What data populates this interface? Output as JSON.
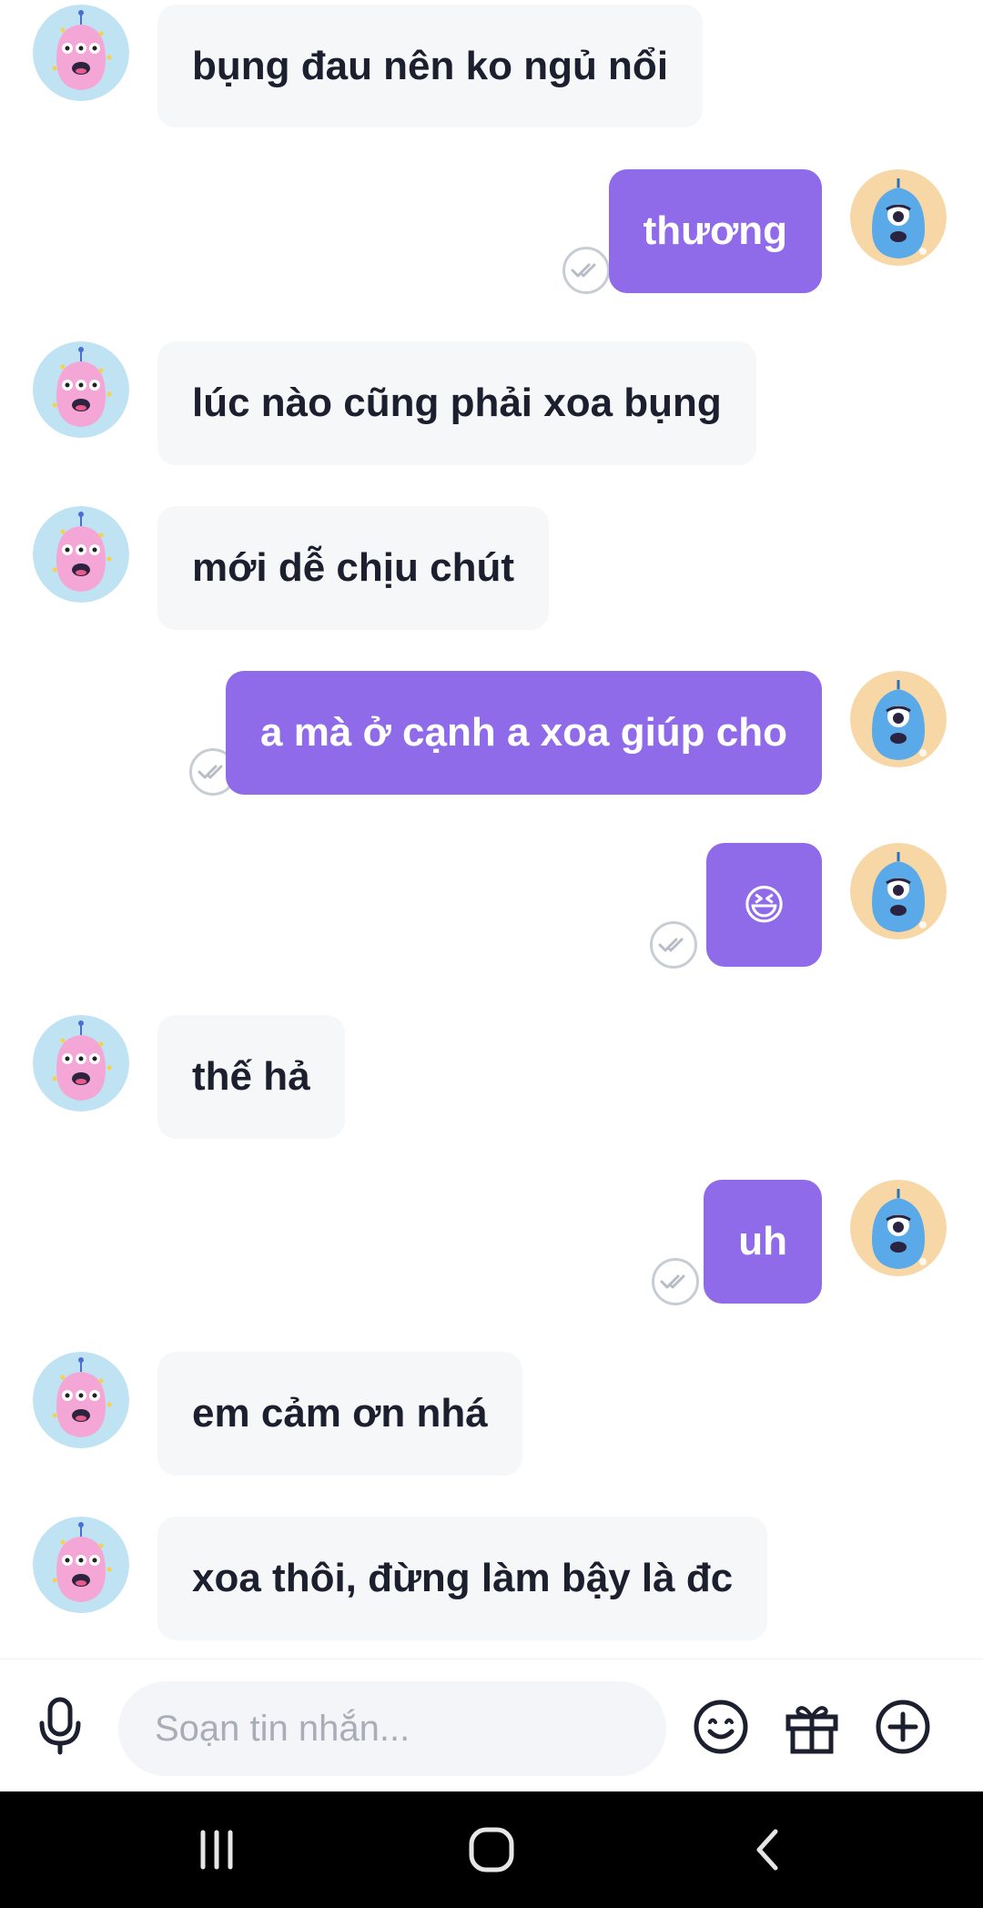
{
  "messages": [
    {
      "side": "in",
      "text": "bụng đau nên ko ngủ nổi"
    },
    {
      "side": "out",
      "text": "thương"
    },
    {
      "side": "in",
      "text": "lúc nào cũng phải xoa bụng"
    },
    {
      "side": "in",
      "text": "mới dễ chịu chút"
    },
    {
      "side": "out",
      "text": "a mà ở cạnh a xoa giúp cho"
    },
    {
      "side": "out",
      "text": "😆"
    },
    {
      "side": "in",
      "text": "thế hả"
    },
    {
      "side": "out",
      "text": "uh"
    },
    {
      "side": "in",
      "text": "em cảm ơn nhá"
    },
    {
      "side": "in",
      "text": "xoa thôi, đừng làm bậy là đc"
    }
  ],
  "composer": {
    "placeholder": "Soạn tin nhắn...",
    "mic_icon": "microphone-icon",
    "emoji_icon": "smiley-icon",
    "gift_icon": "gift-icon",
    "add_icon": "plus-circle-icon"
  },
  "navbar": {
    "recent_icon": "recent-apps-icon",
    "home_icon": "home-icon",
    "back_icon": "back-icon"
  },
  "colors": {
    "outgoing_bubble": "#8f6bea",
    "incoming_bubble": "#f6f7f9",
    "text_dark": "#1b1f2e",
    "placeholder": "#a9adb7"
  }
}
